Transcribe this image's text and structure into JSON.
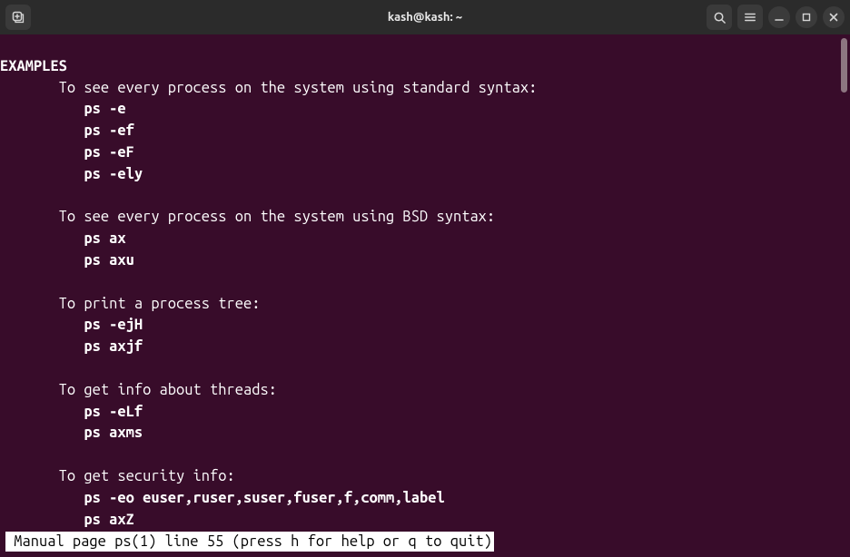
{
  "titlebar": {
    "title": "kash@kash: ~"
  },
  "man": {
    "section_heading": "EXAMPLES",
    "groups": [
      {
        "desc": "To see every process on the system using standard syntax:",
        "cmds": [
          "ps -e",
          "ps -ef",
          "ps -eF",
          "ps -ely"
        ]
      },
      {
        "desc": "To see every process on the system using BSD syntax:",
        "cmds": [
          "ps ax",
          "ps axu"
        ]
      },
      {
        "desc": "To print a process tree:",
        "cmds": [
          "ps -ejH",
          "ps axjf"
        ]
      },
      {
        "desc": "To get info about threads:",
        "cmds": [
          "ps -eLf",
          "ps axms"
        ]
      },
      {
        "desc": "To get security info:",
        "cmds": [
          "ps -eo euser,ruser,suser,fuser,f,comm,label",
          "ps axZ"
        ]
      }
    ],
    "status": " Manual page ps(1) line 55 (press h for help or q to quit)"
  }
}
